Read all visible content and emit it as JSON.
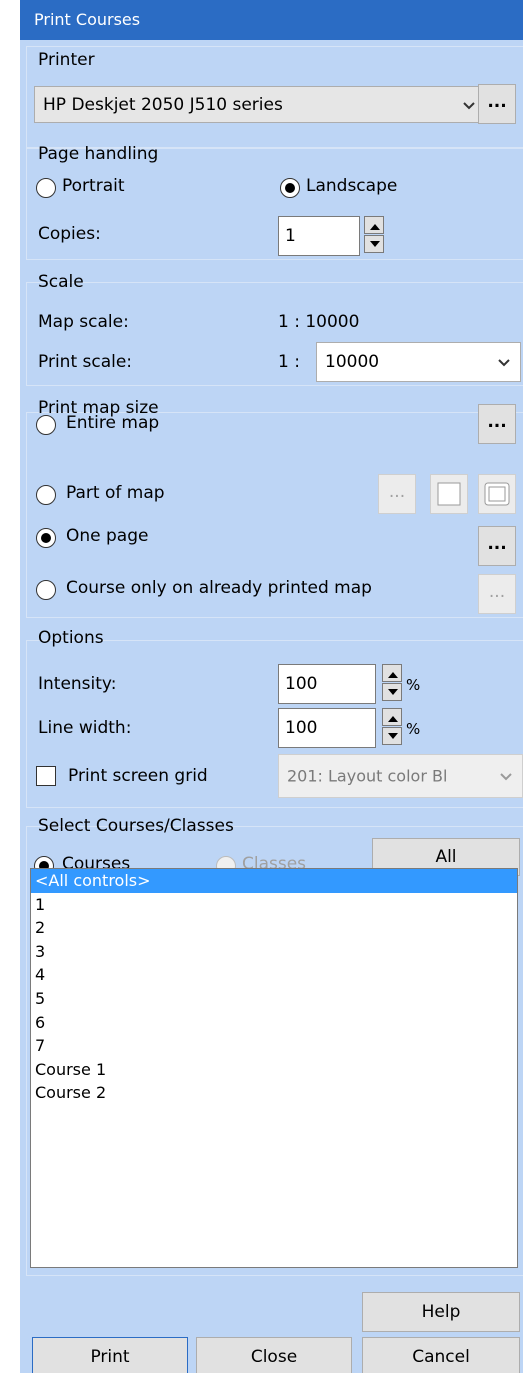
{
  "window": {
    "title": "Print Courses"
  },
  "printer": {
    "group_label": "Printer",
    "selected": "HP Deskjet 2050 J510 series",
    "more_label": "..."
  },
  "page_handling": {
    "group_label": "Page handling",
    "portrait_label": "Portrait",
    "landscape_label": "Landscape",
    "orientation_selected": "Landscape",
    "copies_label": "Copies:",
    "copies_value": "1"
  },
  "scale": {
    "group_label": "Scale",
    "map_scale_label": "Map scale:",
    "map_scale_value": "1 : 10000",
    "print_scale_label": "Print scale:",
    "print_scale_prefix": "1 :",
    "print_scale_value": "10000"
  },
  "print_map_size": {
    "group_label": "Print map size",
    "options": [
      {
        "label": "Entire map",
        "selected": false
      },
      {
        "label": "Part of map",
        "selected": false
      },
      {
        "label": "One page",
        "selected": true
      },
      {
        "label": "Course only on already printed map",
        "selected": false
      }
    ],
    "more_label": "..."
  },
  "options": {
    "group_label": "Options",
    "intensity_label": "Intensity:",
    "intensity_value": "100",
    "line_width_label": "Line width:",
    "line_width_value": "100",
    "percent": "%",
    "grid_label": "Print screen grid",
    "grid_checked": false,
    "grid_color_value": "201: Layout color Bl"
  },
  "select": {
    "group_label": "Select Courses/Classes",
    "courses_label": "Courses",
    "classes_label": "Classes",
    "mode_selected": "Courses",
    "all_label": "All",
    "items": [
      "<All controls>",
      "1",
      "2",
      "3",
      "4",
      "5",
      "6",
      "7",
      "Course 1",
      "Course 2"
    ],
    "selected_index": 0
  },
  "footer": {
    "help_label": "Help",
    "print_label": "Print",
    "close_label": "Close",
    "cancel_label": "Cancel"
  },
  "colors": {
    "panel_bg": "#bdd5f5",
    "title_bg": "#2b6cc4",
    "selection": "#3399ff"
  }
}
